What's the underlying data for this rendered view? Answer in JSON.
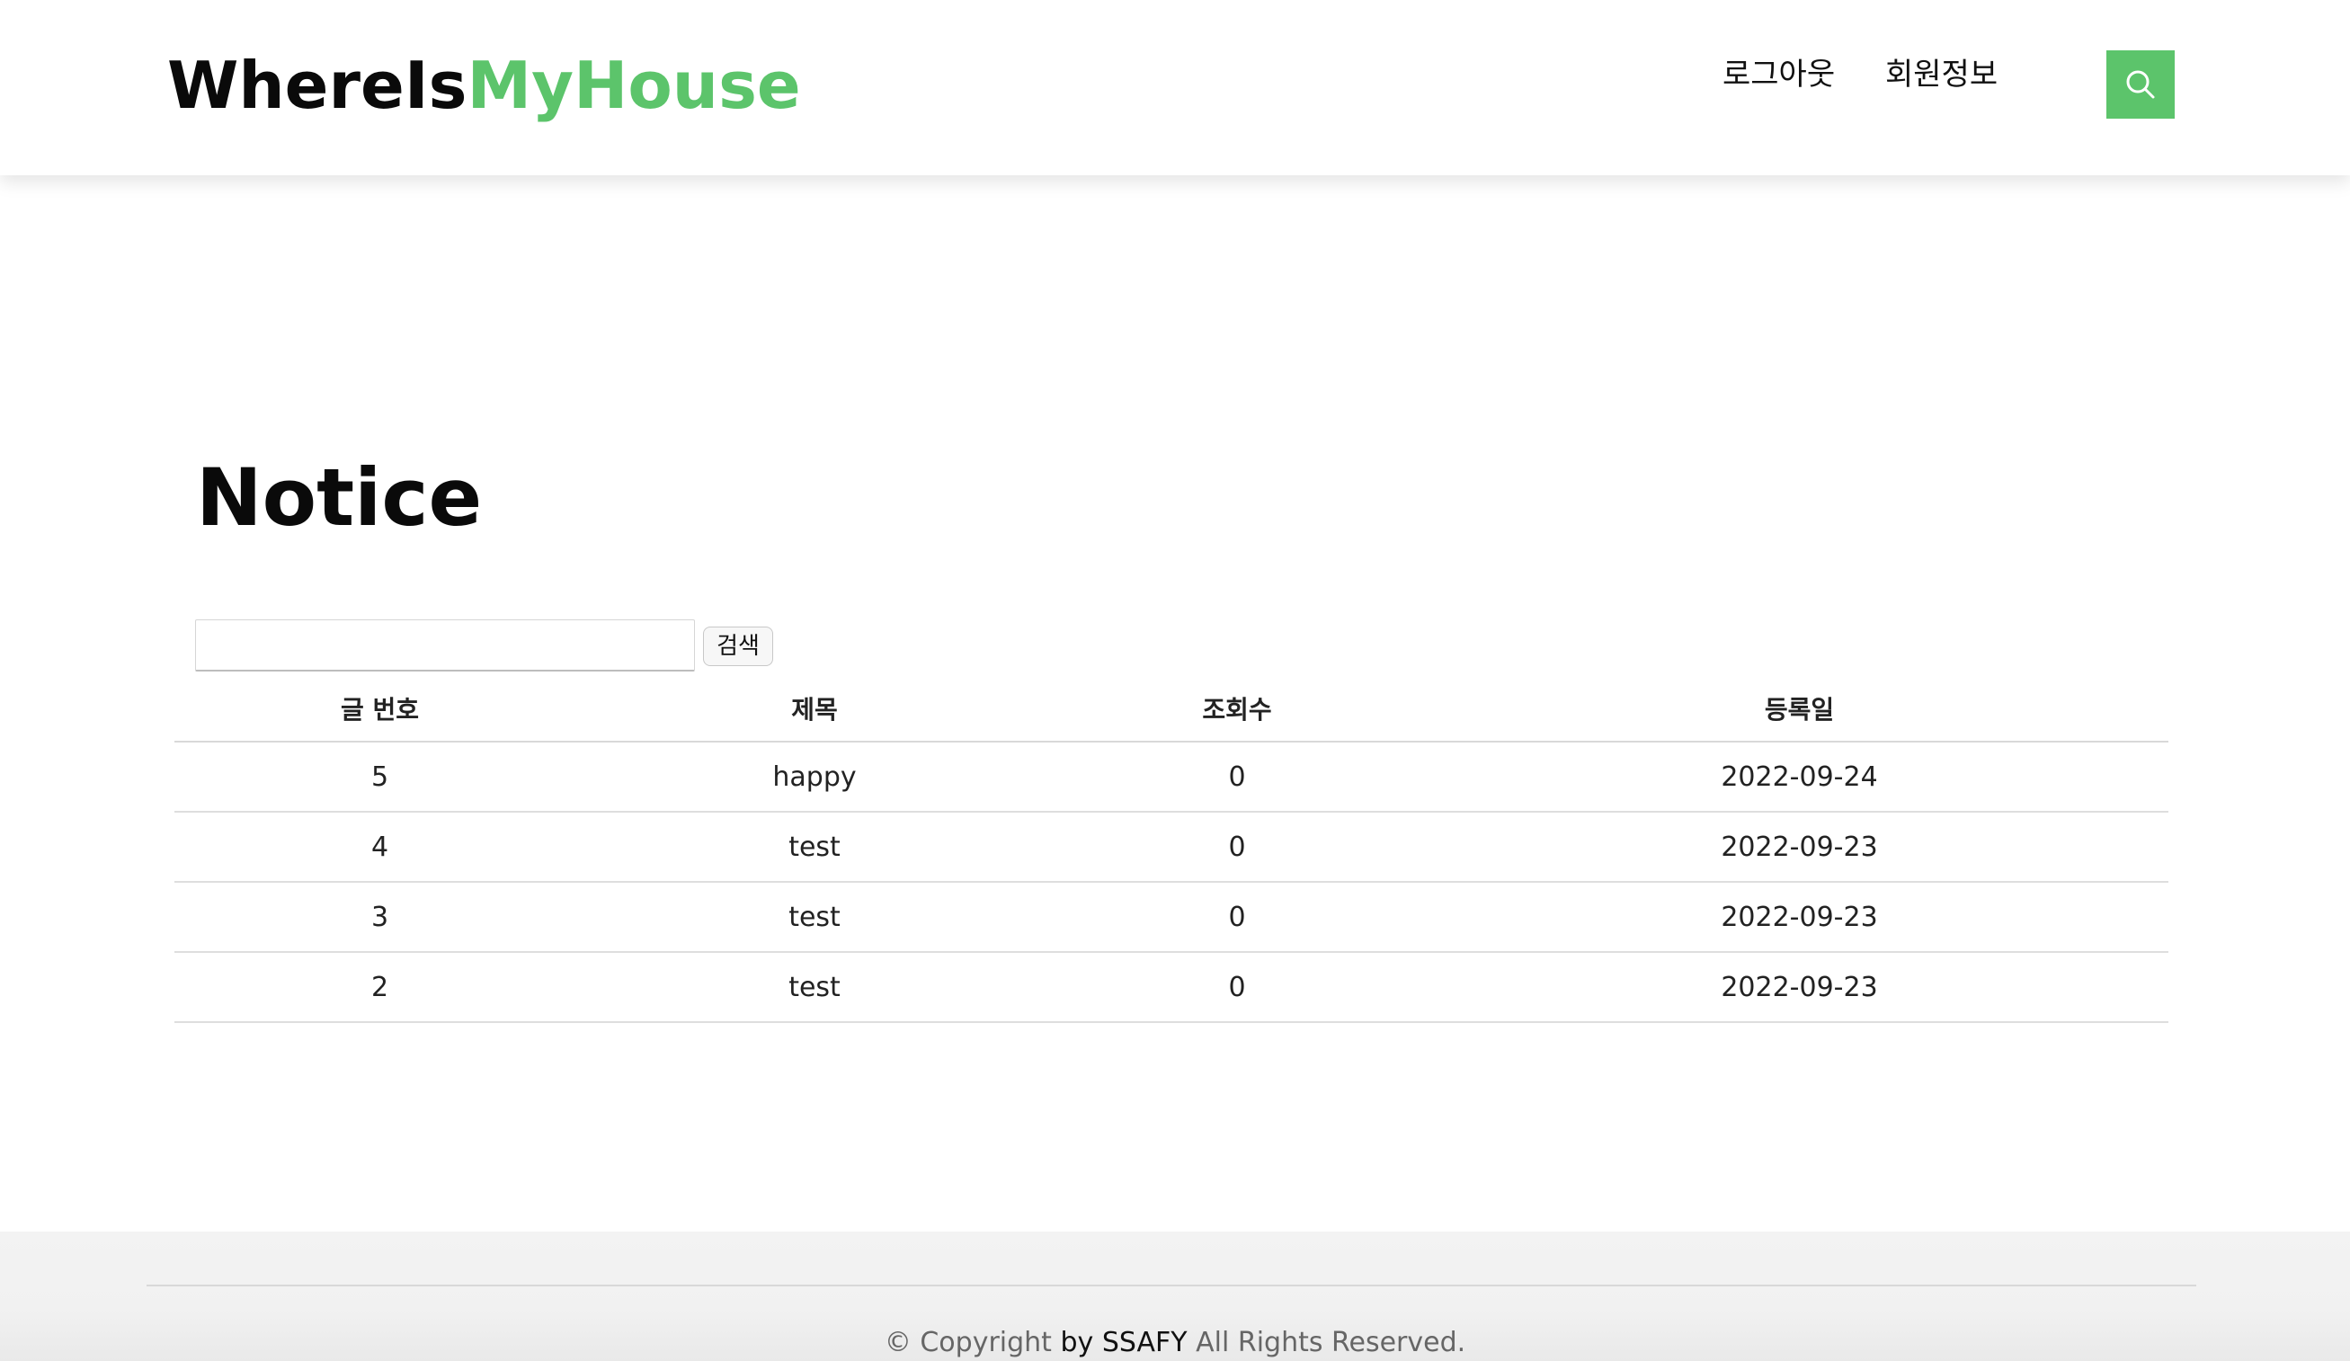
{
  "header": {
    "brand_dark": "WhereIs",
    "brand_green": "MyHouse",
    "nav": {
      "logout": "로그아웃",
      "profile": "회원정보"
    },
    "search_icon": "search-icon"
  },
  "main": {
    "title": "Notice",
    "search": {
      "value": "",
      "placeholder": "",
      "button_label": "검색"
    },
    "table": {
      "columns": [
        "글 번호",
        "제목",
        "조회수",
        "등록일"
      ],
      "rows": [
        {
          "num": "5",
          "title": "happy",
          "views": "0",
          "date": "2022-09-24"
        },
        {
          "num": "4",
          "title": "test",
          "views": "0",
          "date": "2022-09-23"
        },
        {
          "num": "3",
          "title": "test",
          "views": "0",
          "date": "2022-09-23"
        },
        {
          "num": "2",
          "title": "test",
          "views": "0",
          "date": "2022-09-23"
        }
      ]
    }
  },
  "footer": {
    "copyright_prefix": "© Copyright",
    "copyright_by": "by SSAFY",
    "copyright_suffix": "All Rights Reserved."
  },
  "colors": {
    "accent_green": "#5cc46b",
    "footer_bg": "#f3f3f3"
  }
}
